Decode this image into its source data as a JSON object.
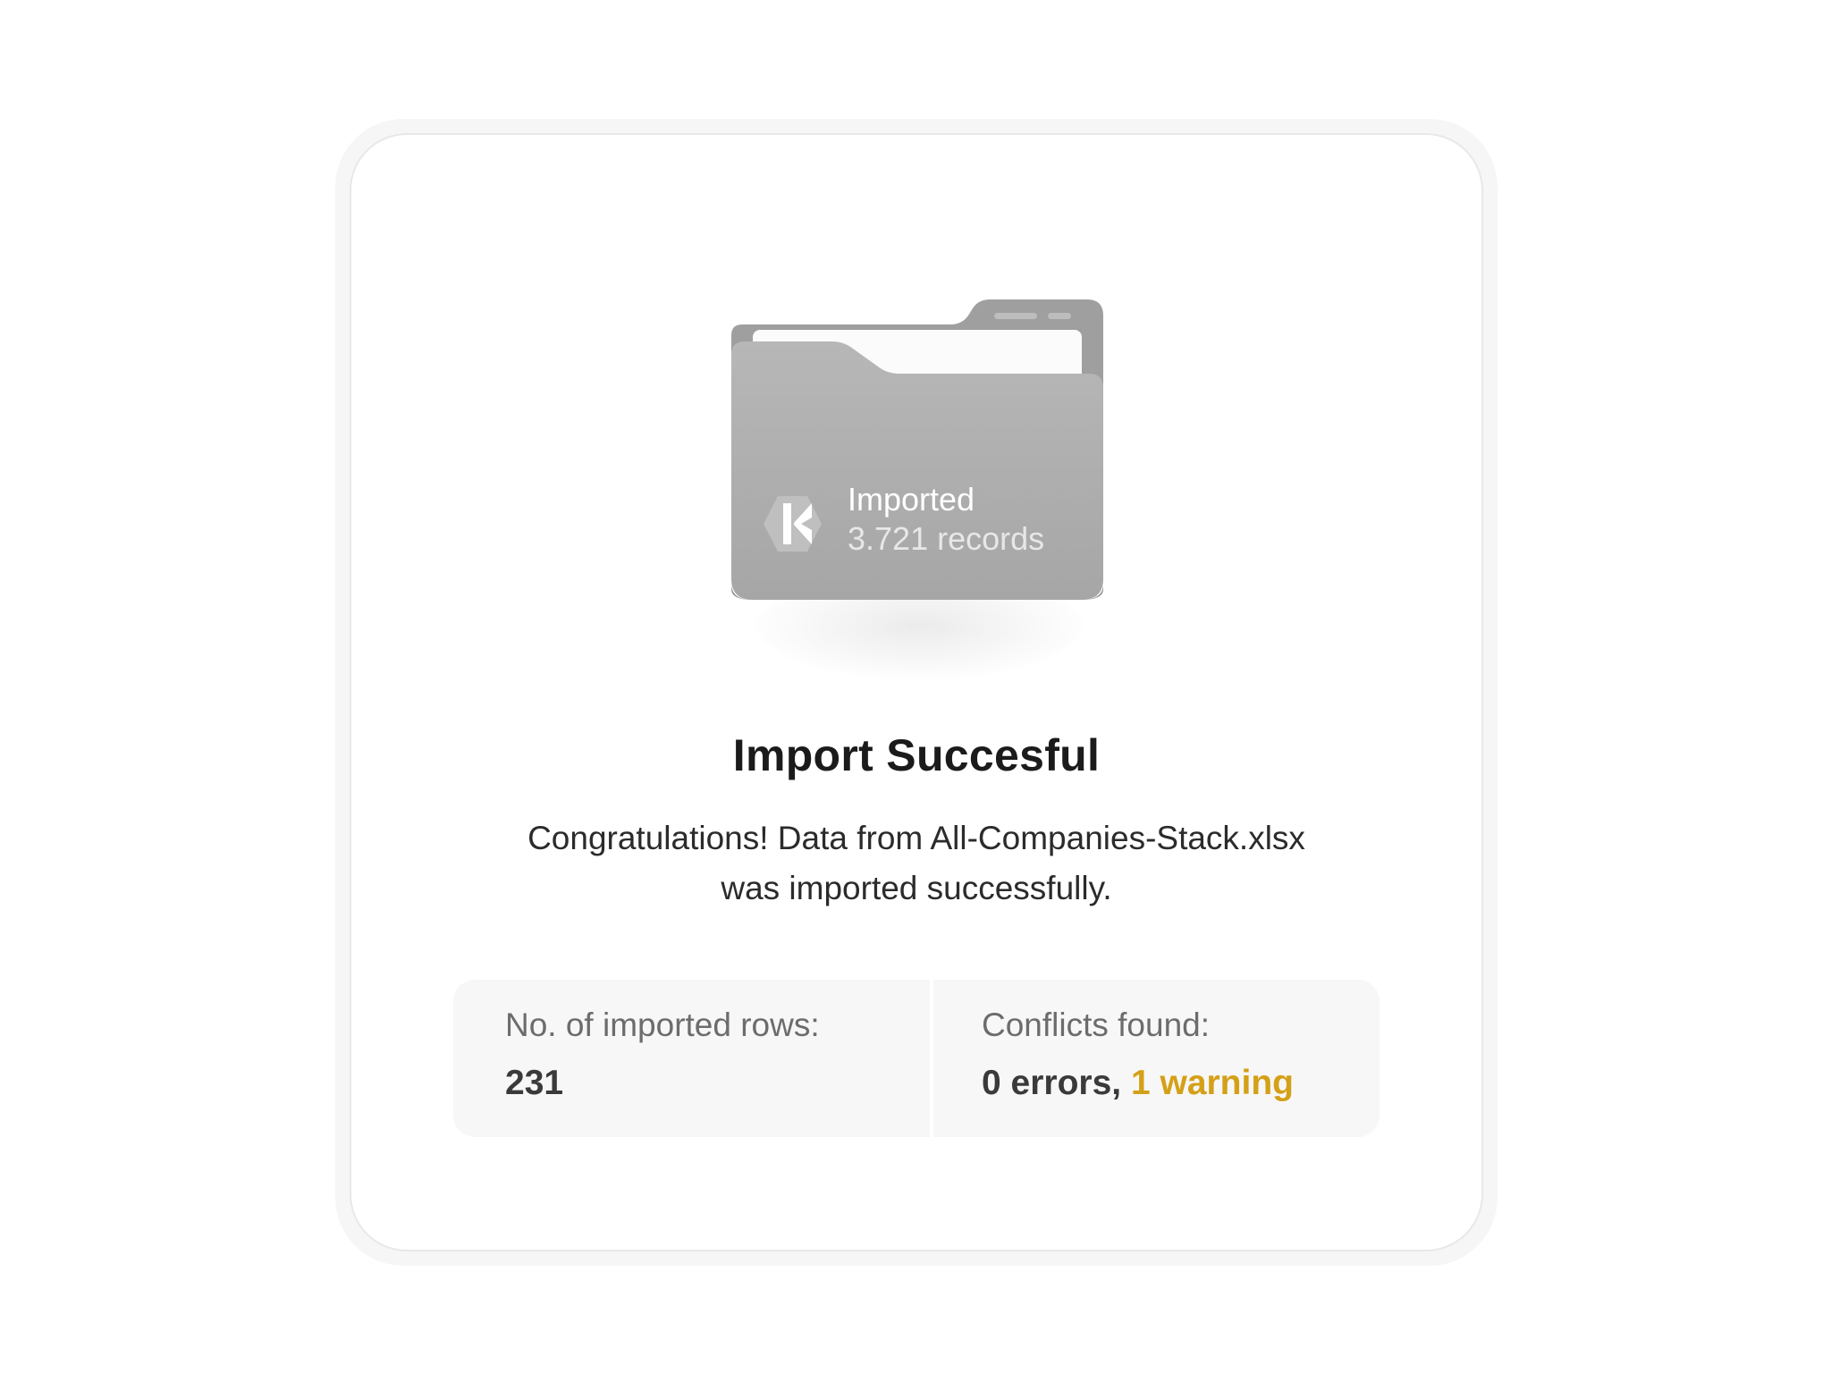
{
  "folder": {
    "status_label": "Imported",
    "records_label": "3.721 records",
    "logo_icon": "k-logo-icon"
  },
  "dialog": {
    "title": "Import Succesful",
    "message_line1": "Congratulations! Data from All-Companies-Stack.xlsx",
    "message_line2": "was imported successfully."
  },
  "stats": {
    "rows_label": "No. of imported rows:",
    "rows_value": "231",
    "conflicts_label": "Conflicts found:",
    "errors_text": "0 errors,",
    "warnings_text": "1 warning"
  },
  "colors": {
    "warning": "#d4a017",
    "folder": "#a9a9a9"
  }
}
